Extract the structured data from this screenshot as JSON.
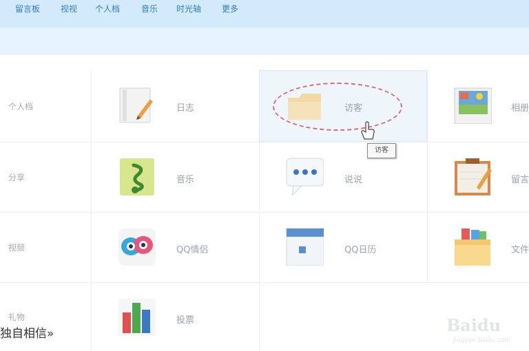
{
  "topnav": {
    "items": [
      "留言板",
      "视视",
      "个人档",
      "音乐",
      "时光轴",
      "更多"
    ]
  },
  "grid": {
    "rows": [
      {
        "left_label": "个人档",
        "cells": [
          {
            "icon": "diary-icon",
            "label": "日志"
          },
          {
            "icon": "folder-icon",
            "label": "访客"
          },
          {
            "icon": "photo-album-icon",
            "label": "相册"
          }
        ]
      },
      {
        "left_label": "分享",
        "cells": [
          {
            "icon": "music-note-icon",
            "label": "音乐"
          },
          {
            "icon": "chat-bubble-icon",
            "label": "说说"
          },
          {
            "icon": "message-board-icon",
            "label": "留言板"
          }
        ]
      },
      {
        "left_label": "视频",
        "cells": [
          {
            "icon": "qq-emoji-icon",
            "label": "QQ情侣"
          },
          {
            "icon": "calendar-icon",
            "label": "QQ日历"
          },
          {
            "icon": "document-folder-icon",
            "label": "文件"
          }
        ]
      },
      {
        "left_label": "礼物",
        "cells": [
          {
            "icon": "bar-chart-icon",
            "label": "投票"
          }
        ]
      }
    ]
  },
  "tooltip": {
    "text": "访客"
  },
  "bottom_link": "独自相信»",
  "watermark": {
    "text": "Baidu",
    "sub": "jingyan.baidu.com"
  }
}
